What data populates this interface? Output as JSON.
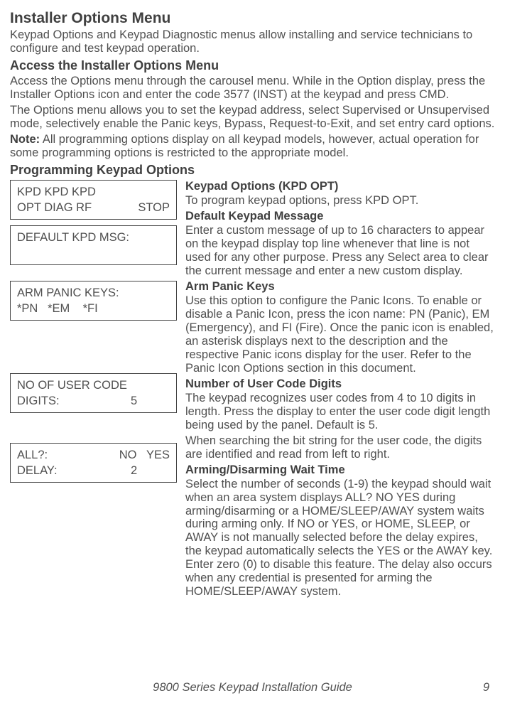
{
  "title": "Installer Options Menu",
  "intro": "Keypad Options and Keypad Diagnostic menus allow installing and service technicians to configure and test keypad operation.",
  "access_heading": "Access the Installer Options Menu",
  "access_p1": "Access the Options menu through the carousel menu. While in the Option display, press the Installer Options icon and enter the code 3577 (INST) at the keypad and press CMD.",
  "access_p2": "The Options menu allows you to set the keypad address, select Supervised or Unsupervised mode, selectively enable the Panic keys, Bypass, Request-to-Exit, and set entry card options.",
  "note_label": "Note:",
  "note_text": " All programming options display on all keypad models, however, actual operation for some programming options is restricted to the appropriate model.",
  "prog_heading": "Programming Keypad Options",
  "displays": {
    "kpd": {
      "line1_left": "KPD KPD KPD",
      "line1_right": "",
      "line2_left": "OPT DIAG RF",
      "line2_right": "STOP"
    },
    "default": {
      "line1": "DEFAULT KPD MSG:"
    },
    "arm": {
      "line1": "ARM PANIC KEYS:",
      "line2": "*PN   *EM    *FI"
    },
    "digits": {
      "line1": "NO OF USER CODE",
      "line2_left": "DIGITS:",
      "line2_right": "5          "
    },
    "delay": {
      "line1_left": "ALL?:",
      "line1_right": "NO   YES",
      "line2_left": "DELAY:",
      "line2_right": "2          "
    }
  },
  "sections": {
    "kpdopt": {
      "heading": "Keypad Options (KPD OPT)",
      "body": "To program keypad options, press KPD OPT."
    },
    "default_msg": {
      "heading": "Default Keypad Message",
      "body": "Enter a custom message of up to 16 characters to appear on the keypad display top line whenever that line is not used for any other purpose. Press any Select area to clear the current message and enter a new custom display."
    },
    "arm_panic": {
      "heading": "Arm Panic Keys",
      "body": "Use this option to configure the Panic Icons. To enable or disable a Panic Icon, press the icon name: PN (Panic), EM (Emergency), and FI (Fire). Once the panic icon is enabled, an asterisk displays next to the description and the respective Panic icons display for the user. Refer to the Panic Icon Options section in this document."
    },
    "digits": {
      "heading": "Number of User Code Digits",
      "body1": "The keypad recognizes user codes from 4 to 10 digits in length. Press the display to enter the user code digit length being used by the panel. Default is 5.",
      "body2": "When searching the bit string for the user code, the digits are identified and read from left to right."
    },
    "delay": {
      "heading": "Arming/Disarming Wait Time",
      "body": "Select the number of seconds (1-9) the keypad should wait when an area system displays ALL? NO YES during arming/disarming or a HOME/SLEEP/AWAY system waits during arming only. If NO or YES, or HOME, SLEEP, or AWAY is not manually selected before the delay expires, the keypad automatically selects the YES or the AWAY key. Enter zero (0) to disable this feature. The delay also occurs when any credential is presented for arming the HOME/SLEEP/AWAY system."
    }
  },
  "footer": {
    "title": "9800 Series Keypad Installation Guide",
    "page": "9"
  }
}
